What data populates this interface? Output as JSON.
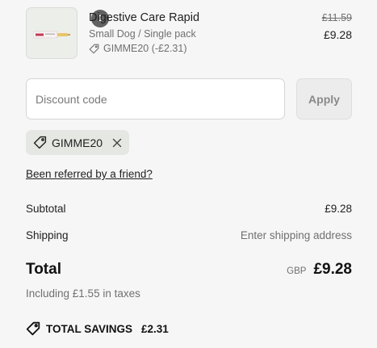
{
  "product": {
    "name": "Digestive Care Rapid",
    "quantity": "1",
    "variant": "Small Dog / Single pack",
    "discount_line": "GIMME20 (-£2.31)",
    "original_price": "£11.59",
    "price": "£9.28",
    "thumbnail_icon": "product-image"
  },
  "discount": {
    "placeholder": "Discount code",
    "value": "",
    "apply_label": "Apply"
  },
  "applied_code": {
    "code": "GIMME20",
    "icon": "tag-icon",
    "remove_icon": "close-icon"
  },
  "referral_link": "Been referred by a friend?",
  "summary": {
    "subtotal_label": "Subtotal",
    "subtotal_value": "£9.28",
    "shipping_label": "Shipping",
    "shipping_value": "Enter shipping address",
    "total_label": "Total",
    "currency": "GBP",
    "total_value": "£9.28",
    "taxes_note": "Including £1.55 in taxes",
    "savings_label": "TOTAL SAVINGS",
    "savings_value": "£2.31"
  },
  "colors": {
    "background": "#f6f6f6",
    "pill_background": "#e4e7e2",
    "muted_text": "#707070",
    "badge": "#616161"
  }
}
